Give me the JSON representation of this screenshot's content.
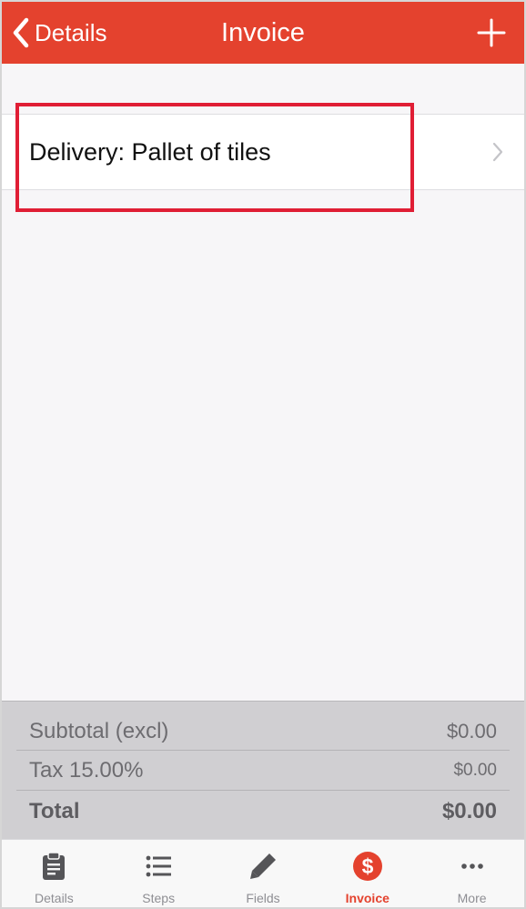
{
  "navbar": {
    "back_label": "Details",
    "title": "Invoice",
    "add_icon": "plus-icon"
  },
  "items": [
    {
      "label": "Delivery: Pallet of tiles"
    }
  ],
  "totals": {
    "subtotal_label": "Subtotal (excl)",
    "subtotal_value": "$0.00",
    "tax_label": "Tax 15.00%",
    "tax_value": "$0.00",
    "total_label": "Total",
    "total_value": "$0.00"
  },
  "tabs": [
    {
      "label": "Details",
      "icon": "clipboard-icon",
      "active": false
    },
    {
      "label": "Steps",
      "icon": "list-icon",
      "active": false
    },
    {
      "label": "Fields",
      "icon": "pencil-icon",
      "active": false
    },
    {
      "label": "Invoice",
      "icon": "dollar-icon",
      "active": true
    },
    {
      "label": "More",
      "icon": "more-icon",
      "active": false
    }
  ],
  "colors": {
    "accent": "#e4422e",
    "highlight": "#e01e35",
    "inactive_tab": "#8e8e93"
  }
}
